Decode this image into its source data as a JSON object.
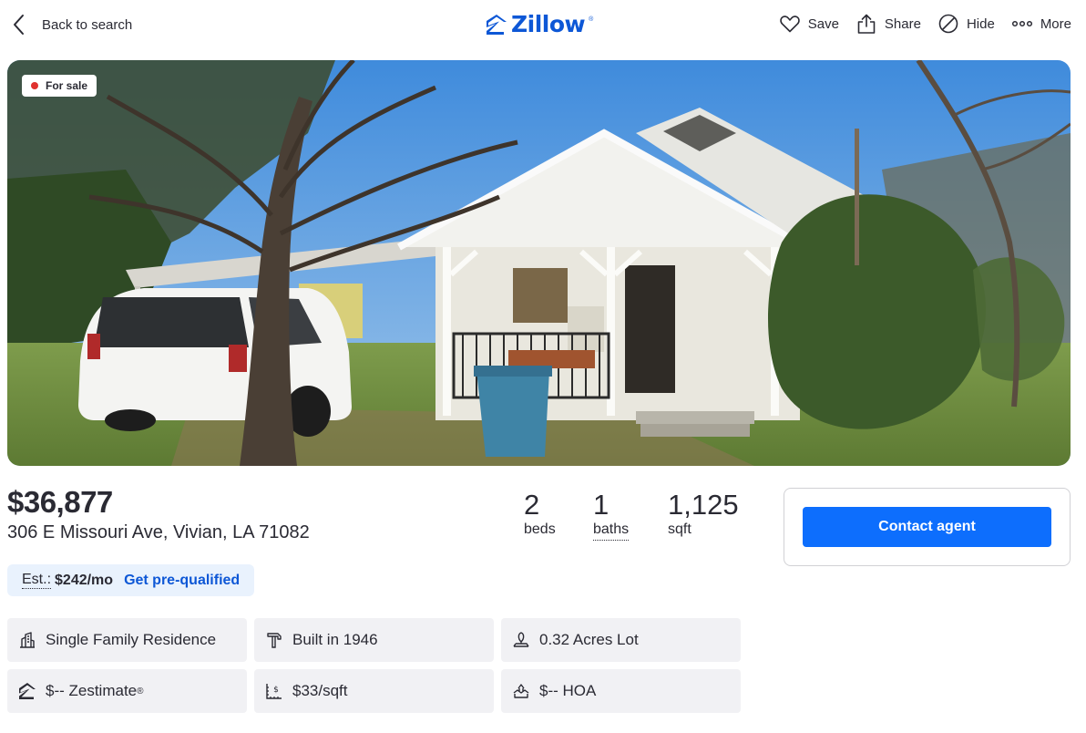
{
  "header": {
    "back_label": "Back to search",
    "logo_text": "Zillow",
    "logo_mark": "®",
    "actions": [
      {
        "label": "Save",
        "icon": "heart-icon"
      },
      {
        "label": "Share",
        "icon": "share-icon"
      },
      {
        "label": "Hide",
        "icon": "hide-icon"
      },
      {
        "label": "More",
        "icon": "more-icon"
      }
    ]
  },
  "photo": {
    "badge": "For sale",
    "badge_color": "#e0322f"
  },
  "listing": {
    "price": "$36,877",
    "address": "306 E Missouri Ave, Vivian, LA 71082",
    "beds": "2",
    "beds_label": "beds",
    "baths": "1",
    "baths_label": "baths",
    "sqft": "1,125",
    "sqft_label": "sqft"
  },
  "estimate": {
    "label": "Est.:",
    "value": "$242/mo",
    "link": "Get pre-qualified"
  },
  "contact": {
    "button_label": "Contact agent",
    "accent": "#0d6efd"
  },
  "facts": [
    {
      "icon": "building-icon",
      "text": "Single Family Residence"
    },
    {
      "icon": "hammer-icon",
      "text": "Built in 1946"
    },
    {
      "icon": "lot-icon",
      "text": "0.32 Acres Lot"
    },
    {
      "icon": "zestimate-icon",
      "text": "$-- Zestimate",
      "mark": "®"
    },
    {
      "icon": "price-per-sqft-icon",
      "text": "$33/sqft"
    },
    {
      "icon": "hoa-icon",
      "text": "$-- HOA"
    }
  ],
  "colors": {
    "brand": "#0d57d6",
    "text": "#2a2a33",
    "fact_bg": "#f1f1f4",
    "estimate_bg": "#e9f2fd"
  }
}
